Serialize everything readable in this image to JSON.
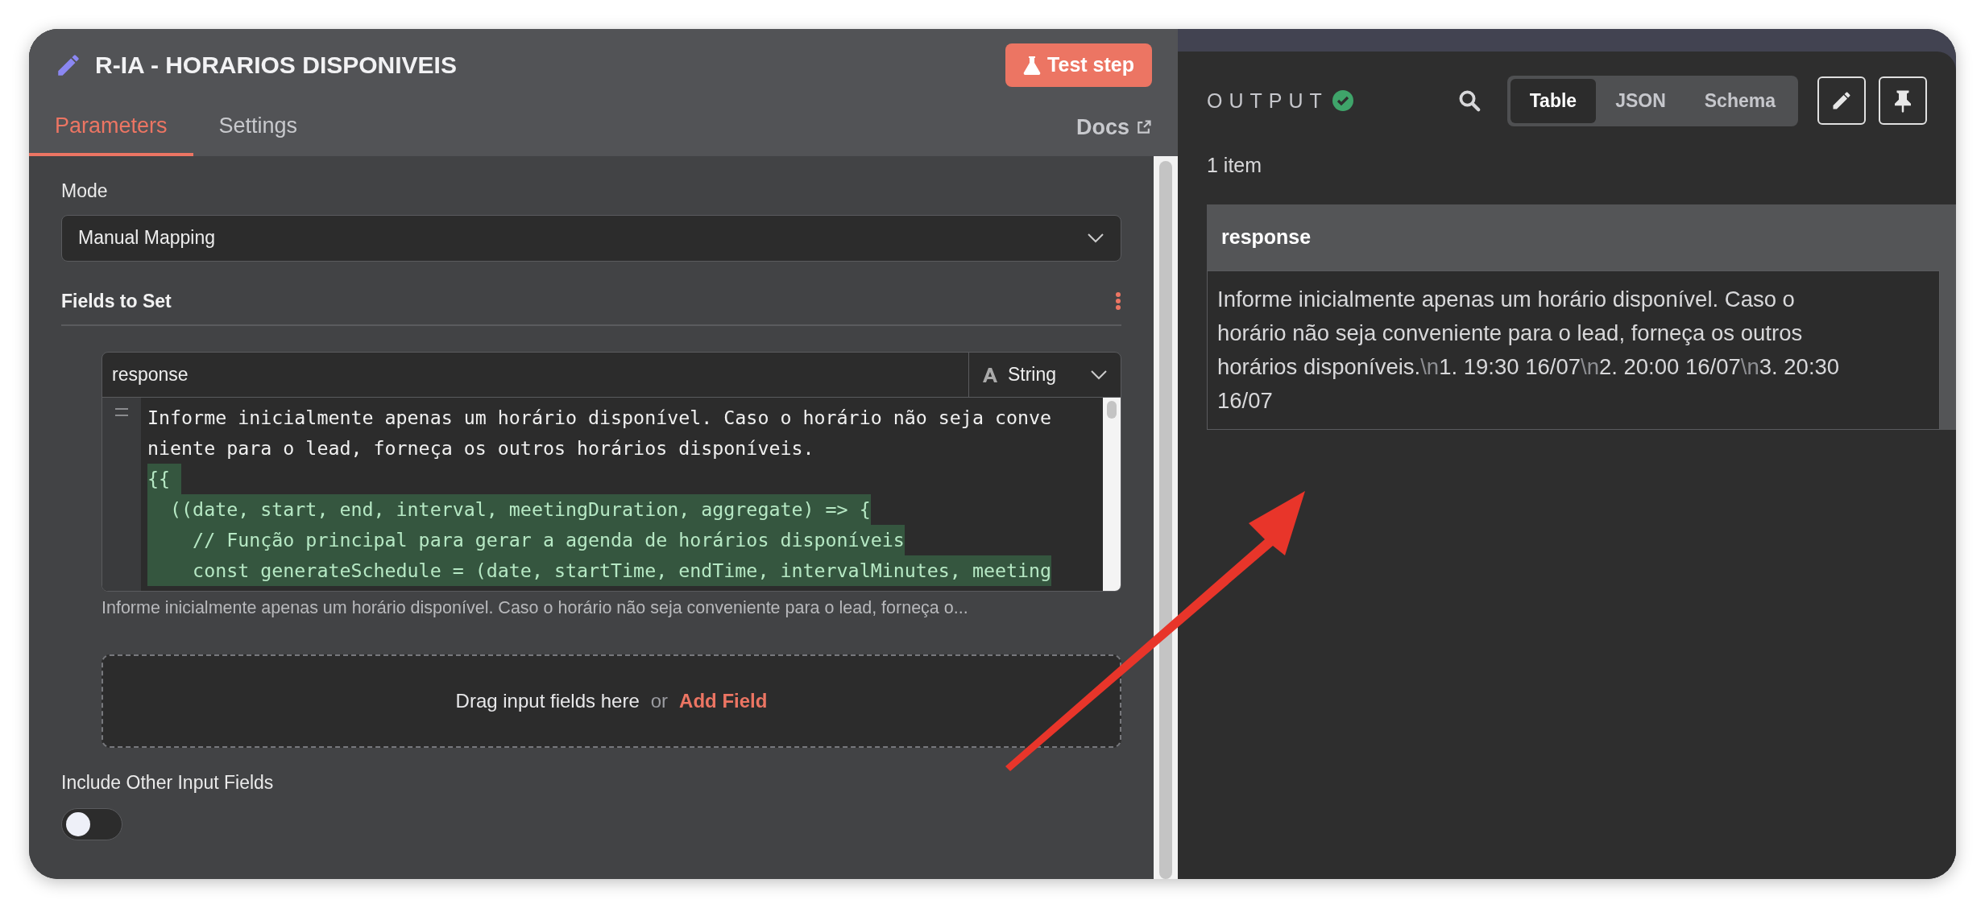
{
  "node": {
    "title": "R-IA - HORARIOS DISPONIVEIS",
    "test_button": "Test step"
  },
  "tabs": [
    {
      "label": "Parameters",
      "selected": true
    },
    {
      "label": "Settings",
      "selected": false
    }
  ],
  "docs_link": "Docs",
  "mode": {
    "label": "Mode",
    "value": "Manual Mapping"
  },
  "fields_to_set": {
    "label": "Fields to Set",
    "field": {
      "name": "response",
      "type": "String",
      "code_lines": [
        {
          "text": "Informe inicialmente apenas um horário disponível. Caso o horário não seja conve",
          "kind": "text"
        },
        {
          "text": "niente para o lead, forneça os outros horários disponíveis.",
          "kind": "text"
        },
        {
          "text": "{{ ",
          "kind": "expression"
        },
        {
          "text": "  ((date, start, end, interval, meetingDuration, aggregate) => {",
          "kind": "expression"
        },
        {
          "text": "    // Função principal para gerar a agenda de horários disponíveis",
          "kind": "expression"
        },
        {
          "text": "    const generateSchedule = (date, startTime, endTime, intervalMinutes, meeting",
          "kind": "expression"
        }
      ],
      "hint": "Informe inicialmente apenas um horário disponível. Caso o horário não seja conveniente para o lead, forneça o..."
    },
    "drop_text": "Drag input fields here",
    "or_text": "or",
    "add_field": "Add Field"
  },
  "include_other": {
    "label": "Include Other Input Fields",
    "on": false
  },
  "output": {
    "title": "OUTPUT",
    "views": [
      {
        "label": "Table",
        "selected": true
      },
      {
        "label": "JSON",
        "selected": false
      },
      {
        "label": "Schema",
        "selected": false
      }
    ],
    "count": "1 item",
    "column": "response",
    "value": [
      {
        "text": "Informe inicialmente apenas um horário disponível. Caso o horário não seja conveniente para o lead, forneça os outros horários disponíveis.",
        "kind": "text"
      },
      {
        "text": "\\n",
        "kind": "escape"
      },
      {
        "text": "1. 19:30 16/07",
        "kind": "text"
      },
      {
        "text": "\\n",
        "kind": "escape"
      },
      {
        "text": "2. 20:00 16/07",
        "kind": "text"
      },
      {
        "text": "\\n",
        "kind": "escape"
      },
      {
        "text": "3. 20:30 16/07",
        "kind": "text"
      }
    ]
  }
}
